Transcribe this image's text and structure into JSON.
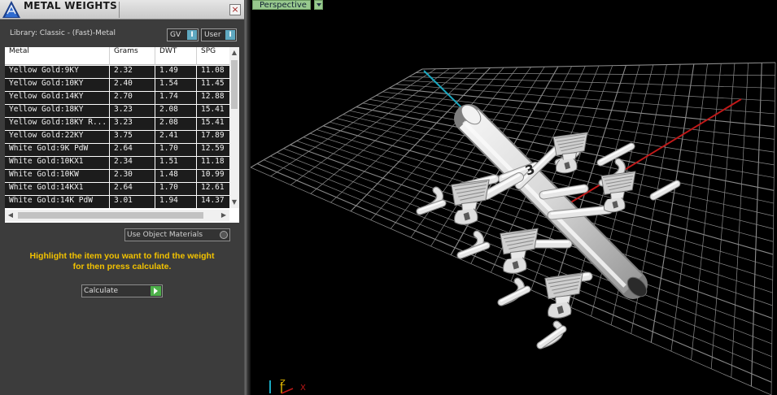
{
  "panel": {
    "title": "METAL WEIGHTS",
    "close_label": "×",
    "library_label": "Library: Classic - (Fast)-Metal",
    "gv_label": "GV",
    "user_label": "User",
    "columns": [
      "Metal",
      "Grams",
      "DWT",
      "SPG"
    ],
    "rows": [
      [
        "Yellow Gold:9KY",
        "2.32",
        "1.49",
        "11.08"
      ],
      [
        "Yellow Gold:10KY",
        "2.40",
        "1.54",
        "11.45"
      ],
      [
        "Yellow Gold:14KY",
        "2.70",
        "1.74",
        "12.88"
      ],
      [
        "Yellow Gold:18KY",
        "3.23",
        "2.08",
        "15.41"
      ],
      [
        "Yellow Gold:18KY R...",
        "3.23",
        "2.08",
        "15.41"
      ],
      [
        "Yellow Gold:22KY",
        "3.75",
        "2.41",
        "17.89"
      ],
      [
        "White Gold:9K PdW",
        "2.64",
        "1.70",
        "12.59"
      ],
      [
        "White Gold:10KX1",
        "2.34",
        "1.51",
        "11.18"
      ],
      [
        "White Gold:10KW",
        "2.30",
        "1.48",
        "10.99"
      ],
      [
        "White Gold:14KX1",
        "2.64",
        "1.70",
        "12.61"
      ],
      [
        "White Gold:14K PdW",
        "3.01",
        "1.94",
        "14.37"
      ]
    ],
    "use_object_materials": "Use Object Materials",
    "instructions_line1": "Highlight the item you want to find the weight",
    "instructions_line2": "for then press calculate.",
    "calculate_label": "Calculate"
  },
  "viewport": {
    "label": "Perspective",
    "axis_labels": [
      "Z",
      "X"
    ],
    "tree_marker": "3",
    "axis_colors": {
      "x": "#c01818",
      "z": "#1aa8c0",
      "grid": "#8a8a8a"
    }
  }
}
